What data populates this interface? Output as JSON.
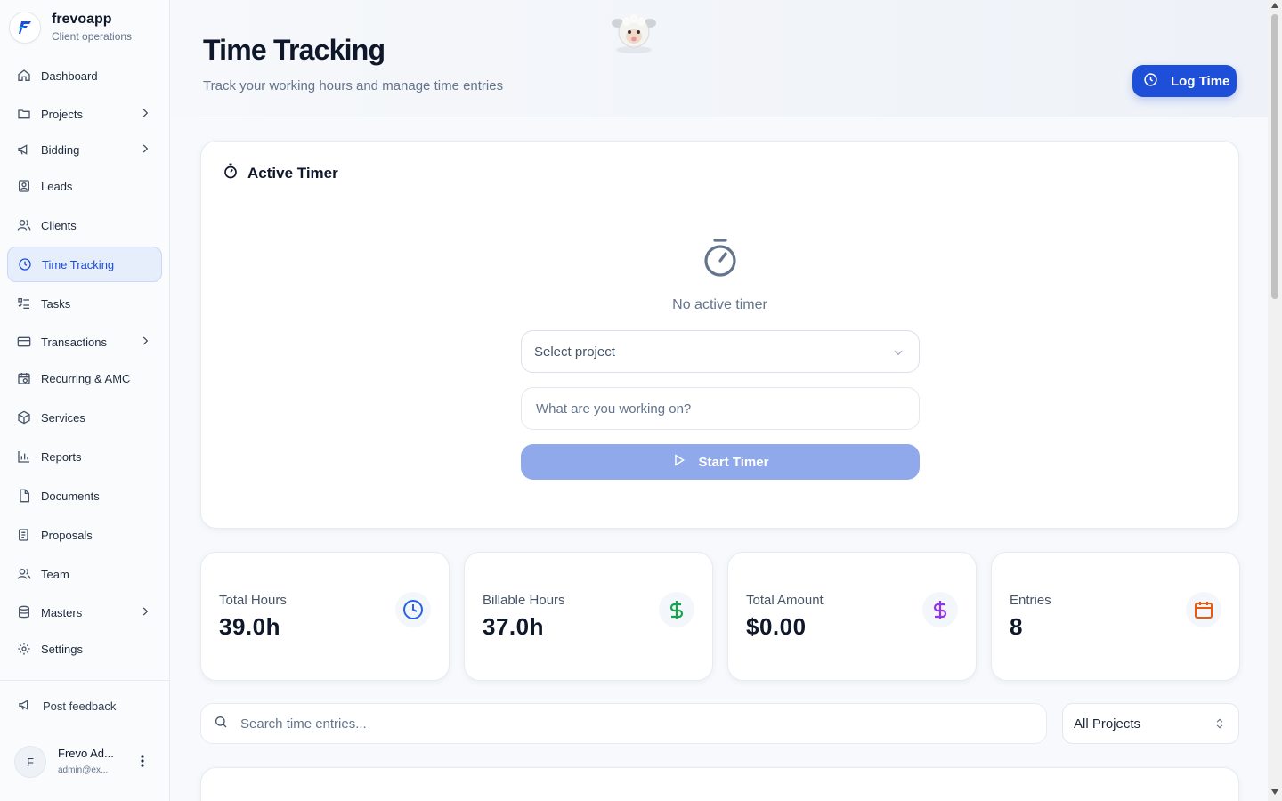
{
  "brand": {
    "name": "frevoapp",
    "subtitle": "Client operations"
  },
  "sidebar": {
    "items": [
      {
        "label": "Dashboard",
        "icon": "home-icon"
      },
      {
        "label": "Projects",
        "icon": "folder-icon"
      },
      {
        "label": "Bidding",
        "icon": "megaphone-icon"
      },
      {
        "label": "Leads",
        "icon": "contact-icon"
      },
      {
        "label": "Clients",
        "icon": "users-icon"
      },
      {
        "label": "Time Tracking",
        "icon": "clock-icon",
        "active": true
      },
      {
        "label": "Tasks",
        "icon": "list-check-icon"
      },
      {
        "label": "Transactions",
        "icon": "credit-card-icon"
      },
      {
        "label": "Recurring & AMC",
        "icon": "calendar-repeat-icon"
      },
      {
        "label": "Services",
        "icon": "package-icon"
      },
      {
        "label": "Reports",
        "icon": "bar-chart-icon"
      },
      {
        "label": "Documents",
        "icon": "file-icon"
      },
      {
        "label": "Proposals",
        "icon": "scroll-icon"
      },
      {
        "label": "Team",
        "icon": "team-icon"
      },
      {
        "label": "Masters",
        "icon": "database-icon"
      },
      {
        "label": "Settings",
        "icon": "gear-icon"
      }
    ],
    "feedback": "Post feedback",
    "user": {
      "initial": "F",
      "name": "Frevo Ad...",
      "email": "admin@ex..."
    }
  },
  "header": {
    "title": "Time Tracking",
    "subtitle": "Track your working hours and manage time entries",
    "log_time": "Log Time"
  },
  "timer": {
    "title": "Active Timer",
    "empty_text": "No active timer",
    "select_placeholder": "Select project",
    "input_placeholder": "What are you working on?",
    "start_label": "Start Timer"
  },
  "stats": [
    {
      "label": "Total Hours",
      "value": "39.0h",
      "icon": "clock-icon",
      "color": "#2563eb"
    },
    {
      "label": "Billable Hours",
      "value": "37.0h",
      "icon": "dollar-icon",
      "color": "#16a34a"
    },
    {
      "label": "Total Amount",
      "value": "$0.00",
      "icon": "dollar-icon",
      "color": "#9333ea"
    },
    {
      "label": "Entries",
      "value": "8",
      "icon": "calendar-icon",
      "color": "#ea580c"
    }
  ],
  "filters": {
    "search_placeholder": "Search time entries...",
    "project_filter": "All Projects"
  },
  "colors": {
    "accent": "#1e4fd8",
    "active_bg": "#e6eefc"
  }
}
